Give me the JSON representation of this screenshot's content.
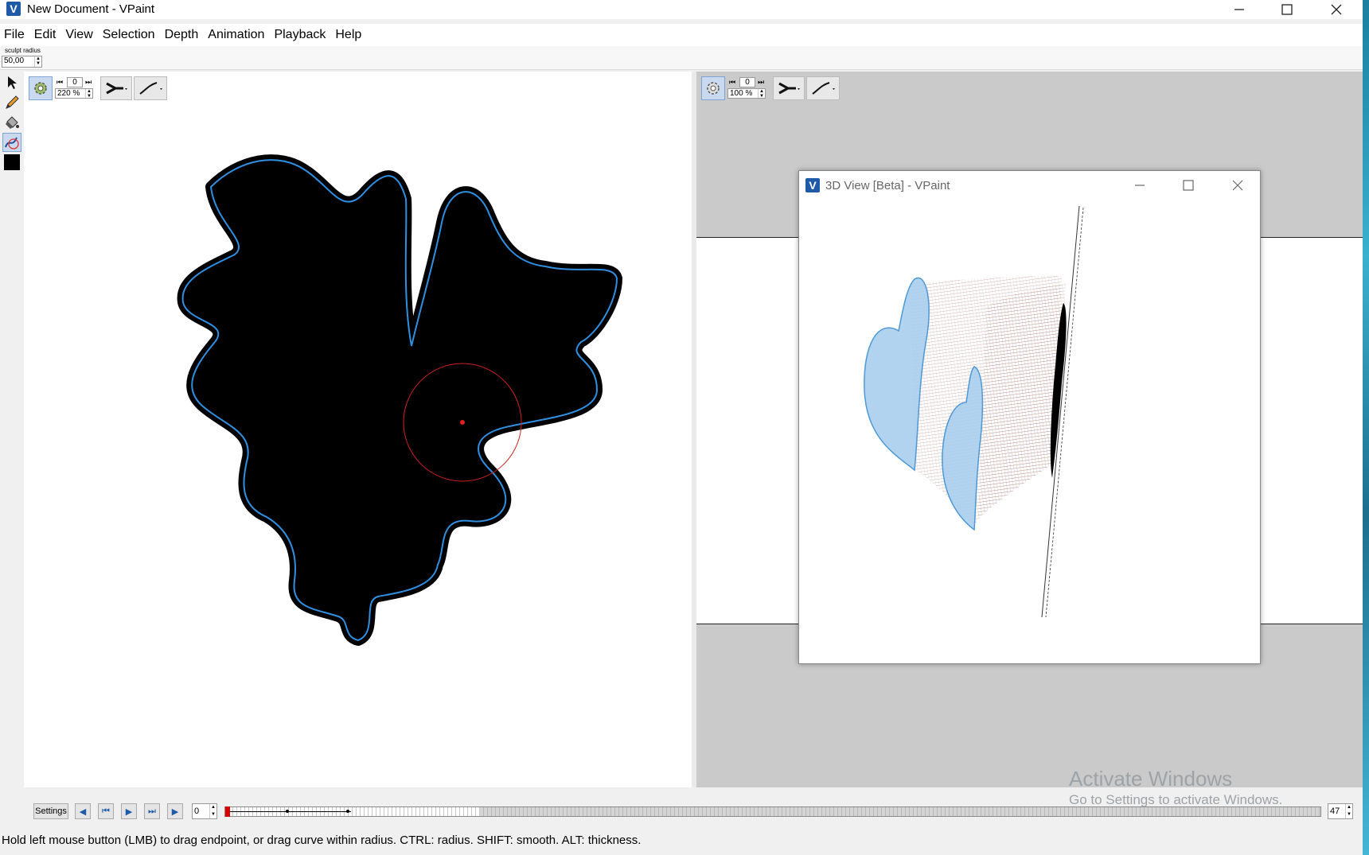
{
  "window": {
    "title": "New Document - VPaint"
  },
  "menu": [
    "File",
    "Edit",
    "View",
    "Selection",
    "Depth",
    "Animation",
    "Playback",
    "Help"
  ],
  "tool_options": {
    "sculpt_radius_label": "sculpt radius",
    "sculpt_radius_value": "50,00"
  },
  "tools": [
    "select-icon",
    "pencil-icon",
    "paint-bucket-icon",
    "sculpt-icon",
    "color-swatch"
  ],
  "view_left": {
    "frame": "0",
    "zoom": "220 %"
  },
  "view_right": {
    "frame": "0",
    "zoom": "100 %"
  },
  "window_3d": {
    "title": "3D View [Beta] - VPaint"
  },
  "timeline": {
    "settings_label": "Settings",
    "current_frame": "0",
    "end_frame": "47"
  },
  "status": "Hold left mouse button (LMB) to drag endpoint, or drag curve within radius. CTRL: radius. SHIFT: smooth. ALT: thickness.",
  "watermark": {
    "line1": "Activate Windows",
    "line2": "Go to Settings to activate Windows."
  },
  "colors": {
    "accent_blue": "#2f8fe0",
    "brush_red": "#e02020",
    "canvas_bg": "#ffffff",
    "view_bg": "#c9cac9"
  }
}
